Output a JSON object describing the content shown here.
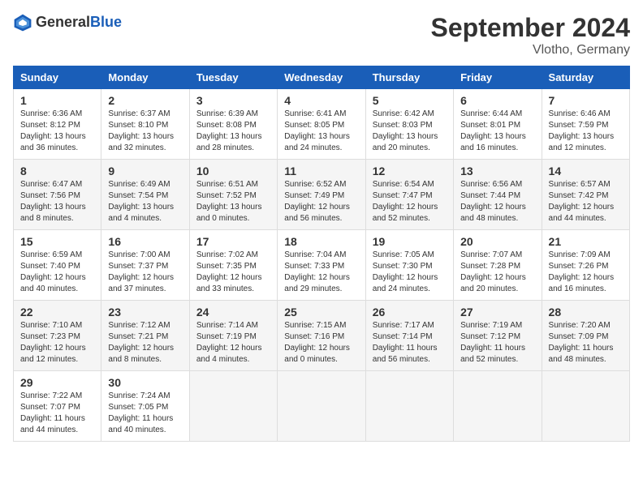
{
  "header": {
    "logo_general": "General",
    "logo_blue": "Blue",
    "month_title": "September 2024",
    "location": "Vlotho, Germany"
  },
  "columns": [
    "Sunday",
    "Monday",
    "Tuesday",
    "Wednesday",
    "Thursday",
    "Friday",
    "Saturday"
  ],
  "weeks": [
    [
      {
        "day": "1",
        "info": "Sunrise: 6:36 AM\nSunset: 8:12 PM\nDaylight: 13 hours\nand 36 minutes."
      },
      {
        "day": "2",
        "info": "Sunrise: 6:37 AM\nSunset: 8:10 PM\nDaylight: 13 hours\nand 32 minutes."
      },
      {
        "day": "3",
        "info": "Sunrise: 6:39 AM\nSunset: 8:08 PM\nDaylight: 13 hours\nand 28 minutes."
      },
      {
        "day": "4",
        "info": "Sunrise: 6:41 AM\nSunset: 8:05 PM\nDaylight: 13 hours\nand 24 minutes."
      },
      {
        "day": "5",
        "info": "Sunrise: 6:42 AM\nSunset: 8:03 PM\nDaylight: 13 hours\nand 20 minutes."
      },
      {
        "day": "6",
        "info": "Sunrise: 6:44 AM\nSunset: 8:01 PM\nDaylight: 13 hours\nand 16 minutes."
      },
      {
        "day": "7",
        "info": "Sunrise: 6:46 AM\nSunset: 7:59 PM\nDaylight: 13 hours\nand 12 minutes."
      }
    ],
    [
      {
        "day": "8",
        "info": "Sunrise: 6:47 AM\nSunset: 7:56 PM\nDaylight: 13 hours\nand 8 minutes."
      },
      {
        "day": "9",
        "info": "Sunrise: 6:49 AM\nSunset: 7:54 PM\nDaylight: 13 hours\nand 4 minutes."
      },
      {
        "day": "10",
        "info": "Sunrise: 6:51 AM\nSunset: 7:52 PM\nDaylight: 13 hours\nand 0 minutes."
      },
      {
        "day": "11",
        "info": "Sunrise: 6:52 AM\nSunset: 7:49 PM\nDaylight: 12 hours\nand 56 minutes."
      },
      {
        "day": "12",
        "info": "Sunrise: 6:54 AM\nSunset: 7:47 PM\nDaylight: 12 hours\nand 52 minutes."
      },
      {
        "day": "13",
        "info": "Sunrise: 6:56 AM\nSunset: 7:44 PM\nDaylight: 12 hours\nand 48 minutes."
      },
      {
        "day": "14",
        "info": "Sunrise: 6:57 AM\nSunset: 7:42 PM\nDaylight: 12 hours\nand 44 minutes."
      }
    ],
    [
      {
        "day": "15",
        "info": "Sunrise: 6:59 AM\nSunset: 7:40 PM\nDaylight: 12 hours\nand 40 minutes."
      },
      {
        "day": "16",
        "info": "Sunrise: 7:00 AM\nSunset: 7:37 PM\nDaylight: 12 hours\nand 37 minutes."
      },
      {
        "day": "17",
        "info": "Sunrise: 7:02 AM\nSunset: 7:35 PM\nDaylight: 12 hours\nand 33 minutes."
      },
      {
        "day": "18",
        "info": "Sunrise: 7:04 AM\nSunset: 7:33 PM\nDaylight: 12 hours\nand 29 minutes."
      },
      {
        "day": "19",
        "info": "Sunrise: 7:05 AM\nSunset: 7:30 PM\nDaylight: 12 hours\nand 24 minutes."
      },
      {
        "day": "20",
        "info": "Sunrise: 7:07 AM\nSunset: 7:28 PM\nDaylight: 12 hours\nand 20 minutes."
      },
      {
        "day": "21",
        "info": "Sunrise: 7:09 AM\nSunset: 7:26 PM\nDaylight: 12 hours\nand 16 minutes."
      }
    ],
    [
      {
        "day": "22",
        "info": "Sunrise: 7:10 AM\nSunset: 7:23 PM\nDaylight: 12 hours\nand 12 minutes."
      },
      {
        "day": "23",
        "info": "Sunrise: 7:12 AM\nSunset: 7:21 PM\nDaylight: 12 hours\nand 8 minutes."
      },
      {
        "day": "24",
        "info": "Sunrise: 7:14 AM\nSunset: 7:19 PM\nDaylight: 12 hours\nand 4 minutes."
      },
      {
        "day": "25",
        "info": "Sunrise: 7:15 AM\nSunset: 7:16 PM\nDaylight: 12 hours\nand 0 minutes."
      },
      {
        "day": "26",
        "info": "Sunrise: 7:17 AM\nSunset: 7:14 PM\nDaylight: 11 hours\nand 56 minutes."
      },
      {
        "day": "27",
        "info": "Sunrise: 7:19 AM\nSunset: 7:12 PM\nDaylight: 11 hours\nand 52 minutes."
      },
      {
        "day": "28",
        "info": "Sunrise: 7:20 AM\nSunset: 7:09 PM\nDaylight: 11 hours\nand 48 minutes."
      }
    ],
    [
      {
        "day": "29",
        "info": "Sunrise: 7:22 AM\nSunset: 7:07 PM\nDaylight: 11 hours\nand 44 minutes."
      },
      {
        "day": "30",
        "info": "Sunrise: 7:24 AM\nSunset: 7:05 PM\nDaylight: 11 hours\nand 40 minutes."
      },
      {
        "day": "",
        "info": ""
      },
      {
        "day": "",
        "info": ""
      },
      {
        "day": "",
        "info": ""
      },
      {
        "day": "",
        "info": ""
      },
      {
        "day": "",
        "info": ""
      }
    ]
  ]
}
